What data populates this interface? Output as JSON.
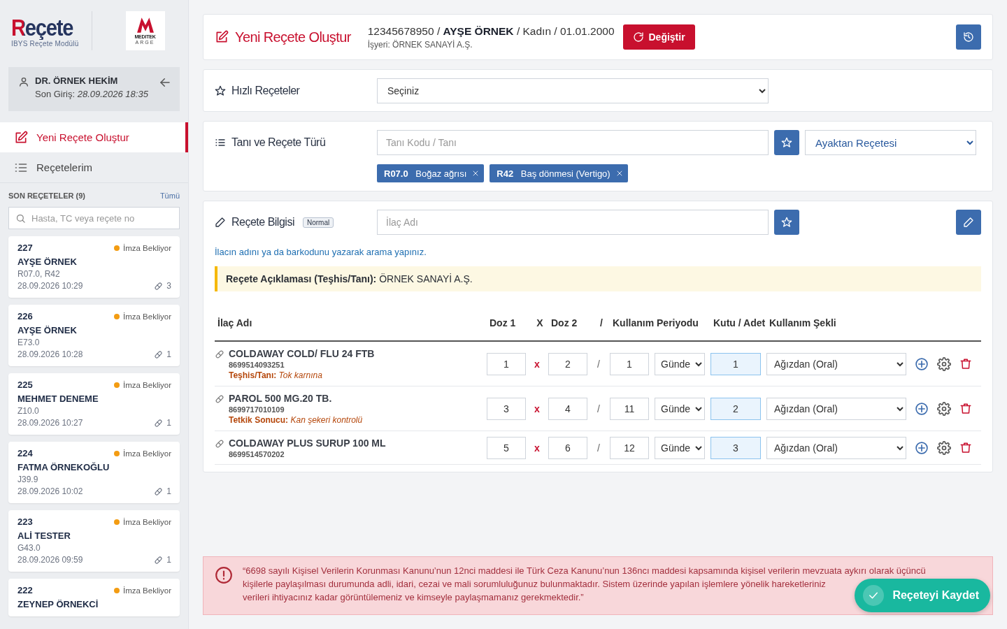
{
  "sidebar": {
    "logo": {
      "title": "Reçete",
      "subtitle": "IBYS Reçete Modülü"
    },
    "brand_logo": {
      "name": "MEDITEK",
      "tagline": "ARGE"
    },
    "user": {
      "name": "DR. ÖRNEK HEKİM",
      "last_login_label": "Son Giriş:",
      "last_login": "28.09.2026 18:35"
    },
    "nav": [
      {
        "kind": "create",
        "label": "Yeni Reçete Oluştur",
        "selected": true
      },
      {
        "kind": "list",
        "label": "Reçetelerim",
        "selected": false
      }
    ],
    "recent": {
      "title": "SON REÇETELER (9)",
      "all_link": "Tümü",
      "search_placeholder": "Hasta, TC veya reçete no",
      "items": [
        {
          "number": "227",
          "status": "İmza Bekliyor",
          "color": "#f39c12",
          "patient": "AYŞE ÖRNEK",
          "codes": "R07.0, R42",
          "datetime": "28.09.2026 10:29",
          "count": "3"
        },
        {
          "number": "226",
          "status": "İmza Bekliyor",
          "color": "#f39c12",
          "patient": "AYŞE ÖRNEK",
          "codes": "E73.0",
          "datetime": "28.09.2026 10:28",
          "count": "1"
        },
        {
          "number": "225",
          "status": "İmza Bekliyor",
          "color": "#f39c12",
          "patient": "MEHMET DENEME",
          "codes": "Z10.0",
          "datetime": "28.09.2026 10:27",
          "count": "1"
        },
        {
          "number": "224",
          "status": "İmza Bekliyor",
          "color": "#f39c12",
          "patient": "FATMA ÖRNEKOĞLU",
          "codes": "J39.9",
          "datetime": "28.09.2026 10:02",
          "count": "1"
        },
        {
          "number": "223",
          "status": "İmza Bekliyor",
          "color": "#f39c12",
          "patient": "ALİ TESTER",
          "codes": "G43.0",
          "datetime": "28.09.2026 09:59",
          "count": "1"
        },
        {
          "number": "222",
          "status": "İmza Bekliyor",
          "color": "#f39c12",
          "patient": "ZEYNEP ÖRNEKCİ"
        }
      ]
    }
  },
  "header": {
    "title": "Yeni Reçete Oluştur",
    "patient": "12345678950 / **AYŞE ÖRNEK** / Kadın / 01.01.2000",
    "employer": "İşyeri: ÖRNEK SANAYİ A.Ş.",
    "change_button": "Değiştir"
  },
  "quick": {
    "label": "Hızlı Reçeteler",
    "select": "Seçiniz"
  },
  "diagnosis": {
    "label": "Tanı ve Reçete Türü",
    "placeholder": "Tanı Kodu / Tanı",
    "type": "Ayaktan Reçetesi",
    "tags": [
      {
        "code": "R07.0",
        "name": "Boğaz ağrısı"
      },
      {
        "code": "R42",
        "name": "Baş dönmesi (Vertigo)"
      }
    ]
  },
  "prescription": {
    "label": "Reçete Bilgisi",
    "badge": "Normal",
    "placeholder": "İlaç Adı",
    "hint": "İlacın adını ya da barkodunu yazarak arama yapınız.",
    "note": "**Reçete Açıklaması (Teşhis/Tanı):** ÖRNEK SANAYİ A.Ş.",
    "columns": [
      "İlaç Adı",
      "Doz 1",
      "X",
      "Doz 2",
      "/",
      "Kullanım Periyodu",
      "Kutu / Adet",
      "Kullanım Şekli"
    ],
    "rows": [
      {
        "name": "COLDAWAY COLD/ FLU 24 FTB",
        "barcode": "8699514093251",
        "note": "**Teşhis/Tanı:** *Tok karnına*",
        "dose1": "1",
        "times": "x",
        "dose2": "2",
        "per": "/",
        "period": "1",
        "unit": "Günde",
        "quantity": "1",
        "usage": "Ağızdan (Oral)"
      },
      {
        "name": "PAROL 500 MG.20 TB.",
        "barcode": "8699717010109",
        "note": "**Tetkik Sonucu:** *Kan şekeri kontrolü*",
        "dose1": "3",
        "times": "x",
        "dose2": "4",
        "per": "/",
        "period": "11",
        "unit": "Günde",
        "quantity": "2",
        "usage": "Ağızdan (Oral)"
      },
      {
        "name": "COLDAWAY PLUS SURUP 100 ML",
        "barcode": "8699514570202",
        "dose1": "5",
        "times": "x",
        "dose2": "6",
        "per": "/",
        "period": "12",
        "unit": "Günde",
        "quantity": "3",
        "usage": "Ağızdan (Oral)"
      }
    ]
  },
  "notice": {
    "lines": [
      "“6698 sayılı Kişisel Verilerin Korunması Kanunu’nun 12nci maddesi ile Türk Ceza Kanunu’nun 136ncı maddesi kapsamında kişisel verilerin mevzuata aykırı olarak üçüncü",
      "kişilerle paylaşılması durumunda adli, idari, cezai ve mali sorumluluğunuz bulunmaktadır. Sistem üzerinde yapılan işlemlere yönelik hareketleriniz",
      "verileri ihtiyacınız kadar görüntülemeniz ve kimseyle paylaşmamanız gerekmektedir.”"
    ]
  },
  "save_button": "Reçeteyi Kaydet"
}
